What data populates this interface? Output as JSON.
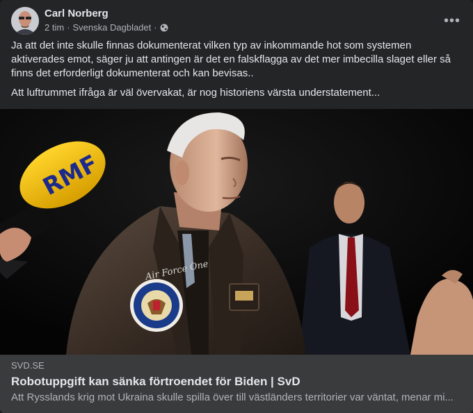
{
  "post": {
    "author": "Carl Norberg",
    "time": "2 tim",
    "separator": "·",
    "group": "Svenska Dagbladet",
    "more_icon": "ellipsis-horizontal-icon",
    "privacy_icon": "globe-icon",
    "body": [
      "Ja att det inte skulle finnas dokumenterat vilken typ av inkommande hot som systemen aktiverades emot, säger ju att antingen är det en falskflagga av det mer imbecilla slaget eller så finns det erforderligt dokumenterat och kan bevisas..",
      "Att luftrummet ifråga är väl övervakat, är nog historiens värsta understatement..."
    ]
  },
  "photo": {
    "mic_brand": "RMF",
    "jacket_text": "Air Force One"
  },
  "link": {
    "domain": "SVD.SE",
    "title": "Robotuppgift kan sänka förtroendet för Biden | SvD",
    "description": "Att Rysslands krig mot Ukraina skulle spilla över till västländers territorier var väntat, menar mi..."
  },
  "colors": {
    "card": "#242526",
    "link_bg": "#3a3b3c",
    "text_primary": "#e4e6eb",
    "text_secondary": "#b0b3b8"
  }
}
